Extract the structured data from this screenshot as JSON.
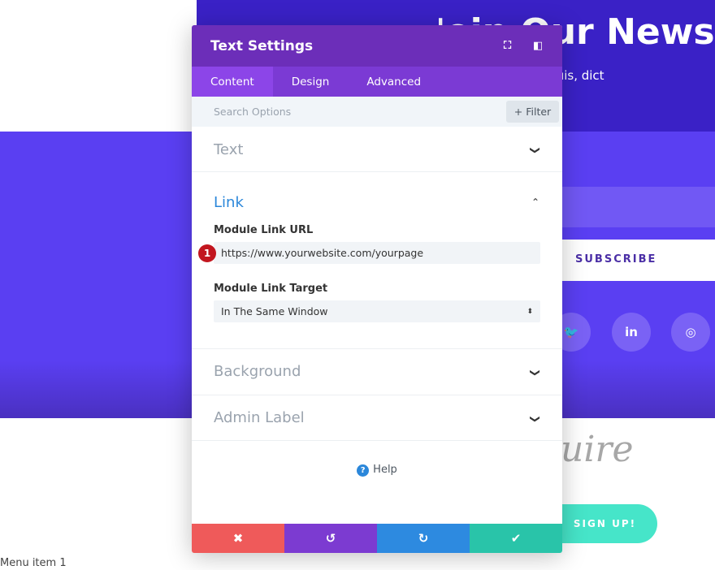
{
  "background": {
    "hero_title": "Join Our Newsletter",
    "hero_subtitle": "pus, semper nibh quis, dict",
    "subscribe": "SUBSCRIBE",
    "social": [
      "twitter-icon",
      "linkedin-icon",
      "instagram-icon"
    ],
    "script_logo": "uire",
    "signup": "SIGN UP!",
    "menu_item": "Menu item 1"
  },
  "modal": {
    "title": "Text Settings",
    "tabs": [
      {
        "label": "Content",
        "active": true
      },
      {
        "label": "Design"
      },
      {
        "label": "Advanced"
      }
    ],
    "search_placeholder": "Search Options",
    "filter_label": "+ Filter",
    "sections": {
      "text": "Text",
      "link": "Link",
      "background": "Background",
      "admin_label": "Admin Label"
    },
    "link": {
      "url_label": "Module Link URL",
      "url_value": "https://www.yourwebsite.com/yourpage",
      "badge": "1",
      "target_label": "Module Link Target",
      "target_value": "In The Same Window"
    },
    "help": "Help"
  },
  "colors": {
    "header": "#6c2eb9",
    "tabs": "#7b3ad4",
    "cancel": "#ef5a5a",
    "undo": "#7c3bd1",
    "redo": "#2d8ae0",
    "save": "#29c4a9",
    "accent": "#2b87da"
  }
}
